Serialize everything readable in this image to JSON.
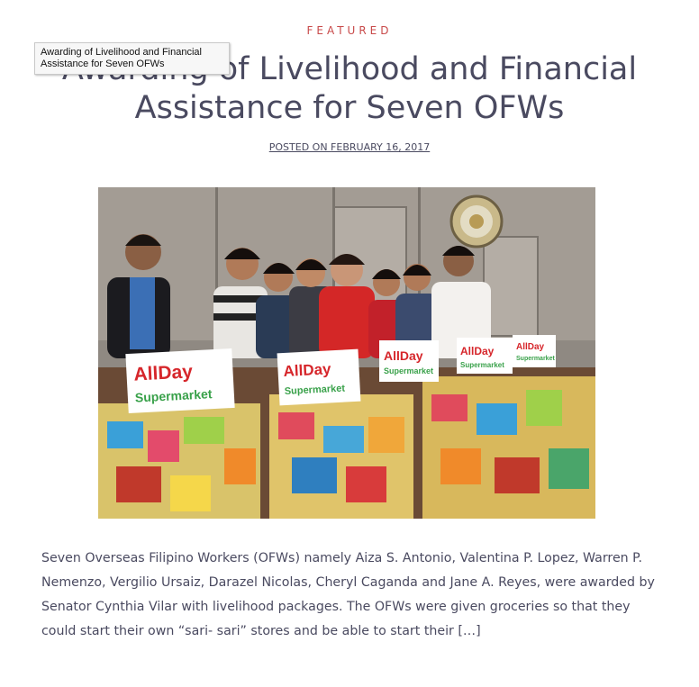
{
  "post": {
    "category": "FEATURED",
    "title": "Awarding of Livelihood and Financial Assistance for Seven OFWs",
    "tooltip": "Awarding of Livelihood and Financial Assistance for Seven OFWs",
    "meta_prefix": "POSTED ON ",
    "date": "FEBRUARY 16, 2017",
    "excerpt": "Seven Overseas Filipino Workers (OFWs) namely Aiza S. Antonio, Valentina P. Lopez, Warren P. Nemenzo, Vergilio Ursaiz, Darazel Nicolas, Cheryl Caganda and Jane A. Reyes, were awarded by Senator Cynthia Vilar with livelihood packages. The OFWs were given groceries so that they could start their own “sari- sari” stores and be able to start their ",
    "read_more": "[…]"
  },
  "photo": {
    "signs": [
      {
        "line1": "AllDay",
        "line2": "Supermarket"
      },
      {
        "line1": "AllDay",
        "line2": "Supermarket"
      },
      {
        "line1": "AllDay",
        "line2": "Supermarket"
      },
      {
        "line1": "AllDay",
        "line2": "Supermarket"
      },
      {
        "line1": "AllDay",
        "line2": "Supermarket"
      }
    ]
  }
}
